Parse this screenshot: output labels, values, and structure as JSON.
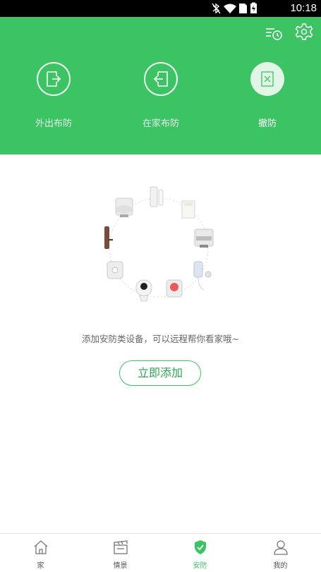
{
  "status_bar": {
    "time": "10:18"
  },
  "header": {
    "modes": [
      {
        "label": "外出布防",
        "icon": "exit-door-icon"
      },
      {
        "label": "在家布防",
        "icon": "enter-door-icon"
      },
      {
        "label": "撤防",
        "icon": "disarm-icon",
        "active": true
      }
    ],
    "icons": [
      "history-log-icon",
      "settings-gear-icon"
    ],
    "accent_color": "#3cc363"
  },
  "empty_state": {
    "hint_text": "添加安防类设备，可以远程帮你看家哦~",
    "add_button_label": "立即添加"
  },
  "bottom_nav": [
    {
      "label": "家",
      "icon": "home-icon"
    },
    {
      "label": "情景",
      "icon": "scene-clapper-icon"
    },
    {
      "label": "安防",
      "icon": "shield-check-icon",
      "active": true
    },
    {
      "label": "我的",
      "icon": "profile-icon"
    }
  ]
}
